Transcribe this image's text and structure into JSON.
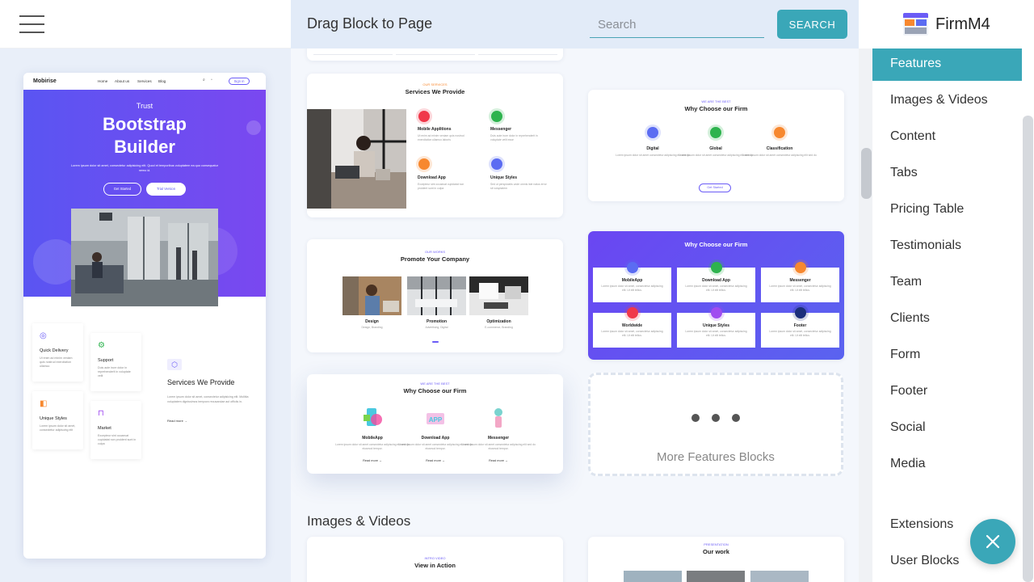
{
  "header": {
    "panel_title": "Drag Block to Page",
    "search_placeholder": "Search",
    "search_button": "SEARCH",
    "brand": "FirmM4"
  },
  "preview": {
    "logo": "Mobirise",
    "nav": [
      "Home",
      "About us",
      "Services",
      "Blog"
    ],
    "signin": "Sign in",
    "hero_small": "Trust",
    "hero_title_1": "Bootstrap",
    "hero_title_2": "Builder",
    "hero_text": "Lorem ipsum dolor sit amet, consectetur adipisicing elit. Quod et temporibus voluptatem ea quo consequatur nemo id.",
    "btn_started": "Get Started",
    "btn_free": "Trial Version",
    "cards": [
      {
        "title": "Quick Delivery",
        "text": "Ut enim ad minim veniam quis nostrud exercitation ullamco"
      },
      {
        "title": "Support",
        "text": "Duis aute irure dolor in reprehenderit in voluptate velit"
      },
      {
        "title": "Unique Styles",
        "text": "Lorem ipsum dolor sit amet, consectetur adipiscing elit"
      },
      {
        "title": "Market",
        "text": "Excepteur sint occaecat cupidatat non proident sunt in culpa"
      }
    ],
    "services_title": "Services We Provide",
    "services_text": "Lorem ipsum dolor sit amet, consectetur adipisicing elit. Mollitia voluptatem dignissimos tempora recusandae aut officiis in.",
    "read_more": "Read more →"
  },
  "blocks": {
    "services": {
      "eyebrow": "OUR SERVICES",
      "title": "Services We Provide",
      "items": [
        {
          "title": "Mobile Applitions",
          "text": "Ut enim ad minim veniam quis nostrud exercitation ullamco laboris",
          "color": "#f0384a"
        },
        {
          "title": "Messenger",
          "text": "Duis aute irure dolor in reprehenderit in voluptate velit esse",
          "color": "#2eb34e"
        },
        {
          "title": "Download App",
          "text": "Excepteur sint occaecat cupidatat non proident sunt in culpa",
          "color": "#f7882f"
        },
        {
          "title": "Unique Styles",
          "text": "Sed ut perspiciatis unde omnis iste natus error sit voluptatem",
          "color": "#5b6cf2"
        }
      ]
    },
    "why_top": {
      "eyebrow": "WE ARE THE BEST",
      "title": "Why Choose our Firm",
      "items": [
        {
          "title": "Digital",
          "text": "Lorem ipsum dolor sit amet consectetur adipiscing elit sed do",
          "color": "#5b6cf2"
        },
        {
          "title": "Global",
          "text": "Lorem ipsum dolor sit amet consectetur adipiscing elit sed do",
          "color": "#2eb34e"
        },
        {
          "title": "Classification",
          "text": "Lorem ipsum dolor sit amet consectetur adipiscing elit sed do",
          "color": "#f7882f"
        }
      ],
      "button": "Get Started"
    },
    "promote": {
      "eyebrow": "OUR WORKS",
      "title": "Promote Your Company",
      "items": [
        {
          "title": "Design",
          "text": "Design, Branding"
        },
        {
          "title": "Promotion",
          "text": "Advertising, Digital"
        },
        {
          "title": "Optimization",
          "text": "E-commerce, Branding"
        }
      ]
    },
    "why_purple": {
      "title": "Why Choose our Firm",
      "items": [
        {
          "title": "MobileApp",
          "color": "#5b6cf2"
        },
        {
          "title": "Download App",
          "color": "#2eb34e"
        },
        {
          "title": "Messenger",
          "color": "#f7882f"
        },
        {
          "title": "Worldwide",
          "color": "#f0384a"
        },
        {
          "title": "Unique Styles",
          "color": "#a04cf0"
        },
        {
          "title": "Footer",
          "color": "#1c2e7a"
        }
      ],
      "text": "Lorem ipsum dolor sit amet, consectetur adipiscing elit. Ut elit tellus."
    },
    "why_bottom": {
      "eyebrow": "WE ARE THE BEST",
      "title": "Why Choose our Firm",
      "items": [
        {
          "title": "MobileApp",
          "text": "Lorem ipsum dolor sit amet consectetur adipiscing elit sed do eiusmod tempor."
        },
        {
          "title": "Download App",
          "text": "Lorem ipsum dolor sit amet consectetur adipiscing elit sed do eiusmod tempor."
        },
        {
          "title": "Messenger",
          "text": "Lorem ipsum dolor sit amet consectetur adipiscing elit sed do eiusmod tempor."
        }
      ],
      "read_more": "Read more →"
    },
    "more_label": "More Features Blocks",
    "images_section": "Images & Videos",
    "intro": {
      "eyebrow": "INTRO VIDEO",
      "title": "View in Action"
    },
    "work": {
      "eyebrow": "PRESENTATION",
      "title": "Our work"
    }
  },
  "categories": [
    "Features",
    "Images & Videos",
    "Content",
    "Tabs",
    "Pricing Table",
    "Testimonials",
    "Team",
    "Clients",
    "Form",
    "Footer",
    "Social",
    "Media",
    "Extensions",
    "User Blocks"
  ],
  "active_category": "Features",
  "colors": {
    "accent": "#3aa7b8",
    "hero": "#5a55f2",
    "panel": "#e2ebf8"
  }
}
